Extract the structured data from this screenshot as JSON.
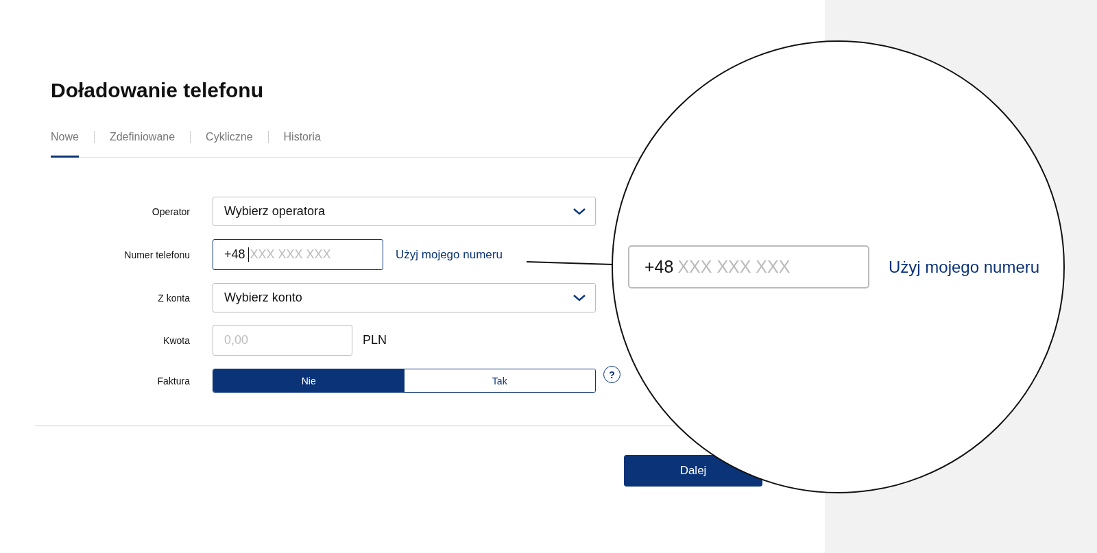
{
  "title": "Doładowanie telefonu",
  "tabs": [
    {
      "label": "Nowe",
      "selected": true
    },
    {
      "label": "Zdefiniowane",
      "selected": false
    },
    {
      "label": "Cykliczne",
      "selected": false
    },
    {
      "label": "Historia",
      "selected": false
    }
  ],
  "form": [
    {
      "kind": "select",
      "label": "Operator",
      "value": "Wybierz operatora"
    },
    {
      "kind": "phone",
      "label": "Numer telefonu",
      "prefix": "+48",
      "placeholder": "XXX XXX XXX",
      "focused": true,
      "link": "Użyj mojego numeru"
    },
    {
      "kind": "select",
      "label": "Z konta",
      "value": "Wybierz konto"
    },
    {
      "kind": "amount",
      "label": "Kwota",
      "placeholder": "0,00",
      "unit": "PLN"
    },
    {
      "kind": "toggle",
      "label": "Faktura",
      "options": [
        {
          "label": "Nie",
          "selected": true
        },
        {
          "label": "Tak",
          "selected": false
        }
      ],
      "help": "?"
    }
  ],
  "submit": "Dalej",
  "magnifier": {
    "prefix": "+48",
    "placeholder": "XXX XXX XXX",
    "link": "Użyj mojego numeru"
  }
}
